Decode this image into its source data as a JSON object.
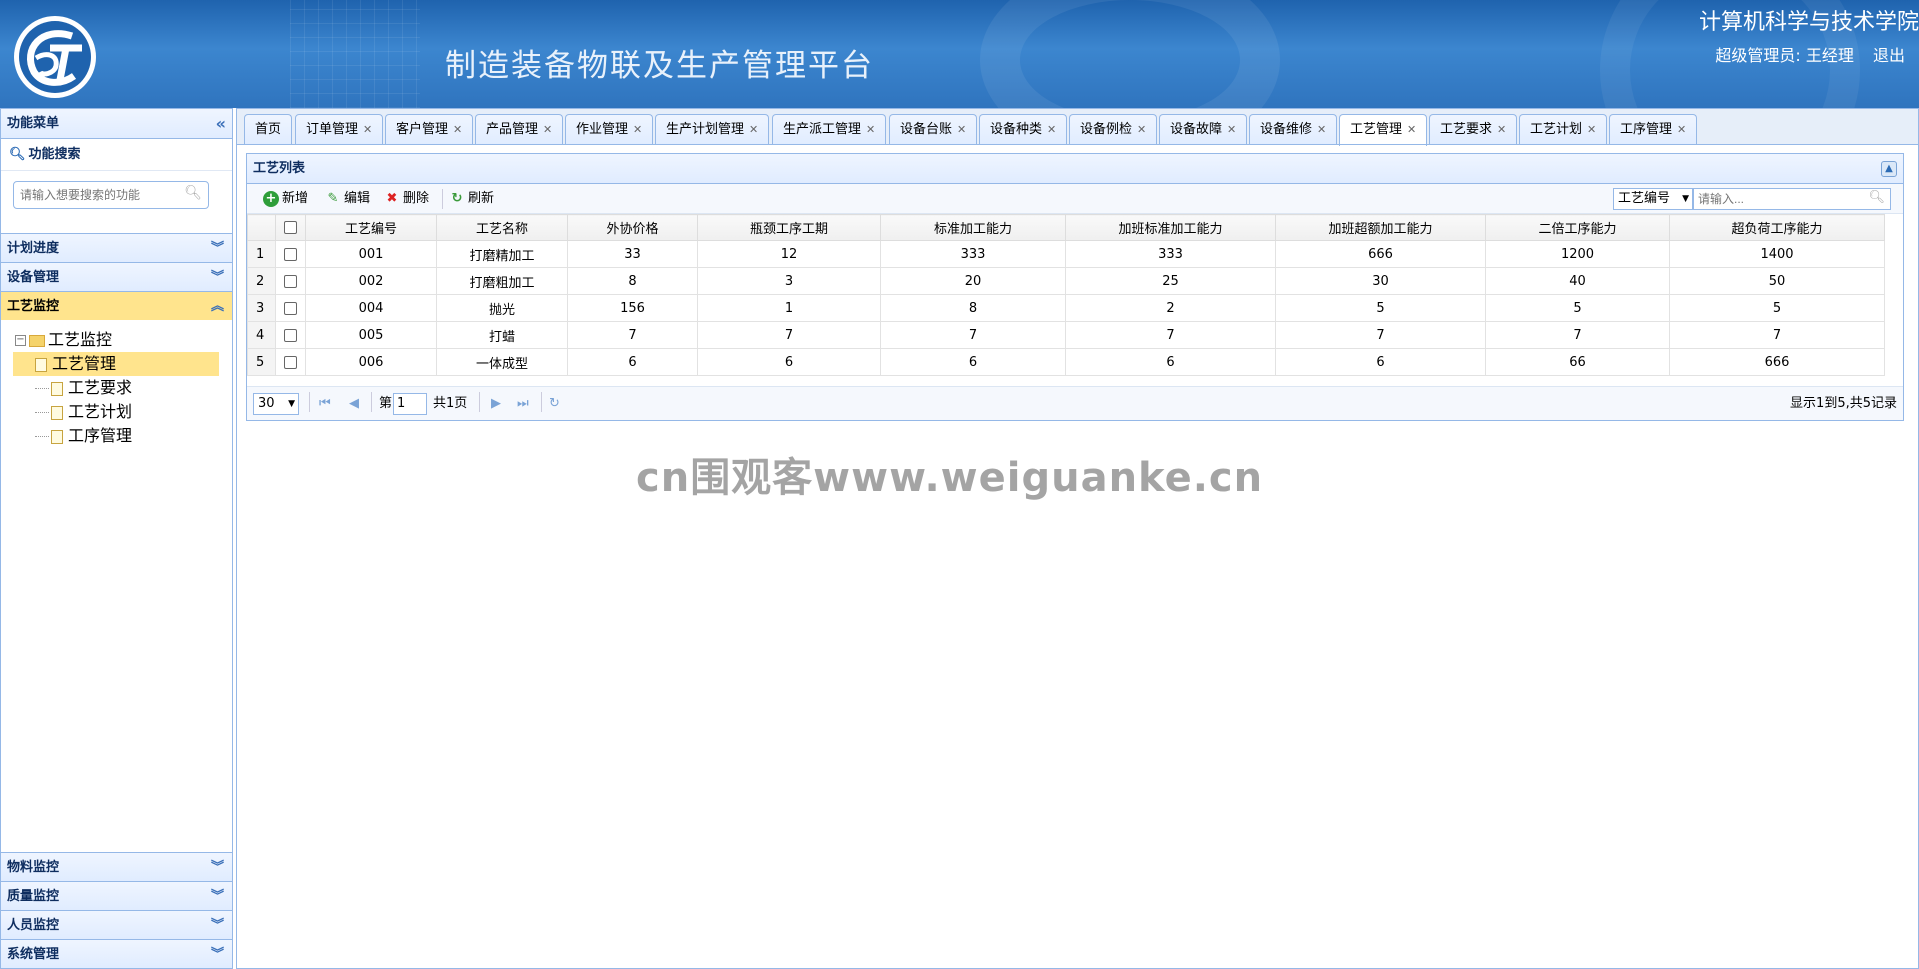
{
  "header": {
    "system_title": "制造装备物联及生产管理平台",
    "school": "计算机科学与技术学院",
    "user_label": "超级管理员: 王经理",
    "logout": "退出",
    "colors": {
      "header_bg": "#2f74be"
    }
  },
  "sidebar": {
    "title": "功能菜单",
    "search_title": "功能搜索",
    "search_placeholder": "请输入想要搜索的功能",
    "top_sections": [
      "计划进度",
      "设备管理",
      "工艺监控"
    ],
    "active_section": "工艺监控",
    "tree": {
      "root": "工艺监控",
      "children": [
        "工艺管理",
        "工艺要求",
        "工艺计划",
        "工序管理"
      ],
      "selected": "工艺管理"
    },
    "bottom_sections": [
      "物料监控",
      "质量监控",
      "人员监控",
      "系统管理"
    ]
  },
  "tabs": [
    {
      "label": "首页",
      "closable": false
    },
    {
      "label": "订单管理",
      "closable": true
    },
    {
      "label": "客户管理",
      "closable": true
    },
    {
      "label": "产品管理",
      "closable": true
    },
    {
      "label": "作业管理",
      "closable": true
    },
    {
      "label": "生产计划管理",
      "closable": true
    },
    {
      "label": "生产派工管理",
      "closable": true
    },
    {
      "label": "设备台账",
      "closable": true
    },
    {
      "label": "设备种类",
      "closable": true
    },
    {
      "label": "设备例检",
      "closable": true
    },
    {
      "label": "设备故障",
      "closable": true
    },
    {
      "label": "设备维修",
      "closable": true
    },
    {
      "label": "工艺管理",
      "closable": true,
      "active": true
    },
    {
      "label": "工艺要求",
      "closable": true
    },
    {
      "label": "工艺计划",
      "closable": true
    },
    {
      "label": "工序管理",
      "closable": true
    }
  ],
  "panel": {
    "title": "工艺列表",
    "toolbar": {
      "add": "新增",
      "edit": "编辑",
      "delete": "删除",
      "refresh": "刷新"
    },
    "search_field": "工艺编号",
    "search_placeholder": "请输入..."
  },
  "table": {
    "columns": [
      "工艺编号",
      "工艺名称",
      "外协价格",
      "瓶颈工序工期",
      "标准加工能力",
      "加班标准加工能力",
      "加班超额加工能力",
      "二倍工序能力",
      "超负荷工序能力"
    ],
    "rows": [
      [
        "1",
        "001",
        "打磨精加工",
        "33",
        "12",
        "333",
        "333",
        "666",
        "1200",
        "1400"
      ],
      [
        "2",
        "002",
        "打磨粗加工",
        "8",
        "3",
        "20",
        "25",
        "30",
        "40",
        "50"
      ],
      [
        "3",
        "004",
        "抛光",
        "156",
        "1",
        "8",
        "2",
        "5",
        "5",
        "5"
      ],
      [
        "4",
        "005",
        "打蜡",
        "7",
        "7",
        "7",
        "7",
        "7",
        "7",
        "7"
      ],
      [
        "5",
        "006",
        "一体成型",
        "6",
        "6",
        "6",
        "6",
        "6",
        "66",
        "666"
      ]
    ]
  },
  "pager": {
    "page_size": "30",
    "page_prefix": "第",
    "page_value": "1",
    "page_total": "共1页",
    "info": "显示1到5,共5记录"
  },
  "watermark": "cn围观客www.weiguanke.cn"
}
